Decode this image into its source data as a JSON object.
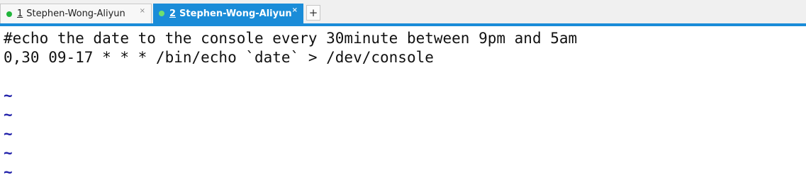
{
  "tabs": [
    {
      "number": "1",
      "title": "Stephen-Wong-Aliyun",
      "close_icon": "×",
      "status_color": "#21b53b",
      "active": false
    },
    {
      "number": "2",
      "title": "Stephen-Wong-Aliyun",
      "close_icon": "×",
      "status_color": "#6fe06f",
      "active": true
    }
  ],
  "new_tab_icon": "+",
  "accent_color": "#1a8cd8",
  "terminal": {
    "lines": [
      "#echo the date to the console every 30minute between 9pm and 5am",
      "0,30 09-17 * * * /bin/echo `date` > /dev/console"
    ],
    "empty_line_markers": [
      "~",
      "~",
      "~",
      "~",
      "~"
    ],
    "marker_color": "#2222aa"
  }
}
